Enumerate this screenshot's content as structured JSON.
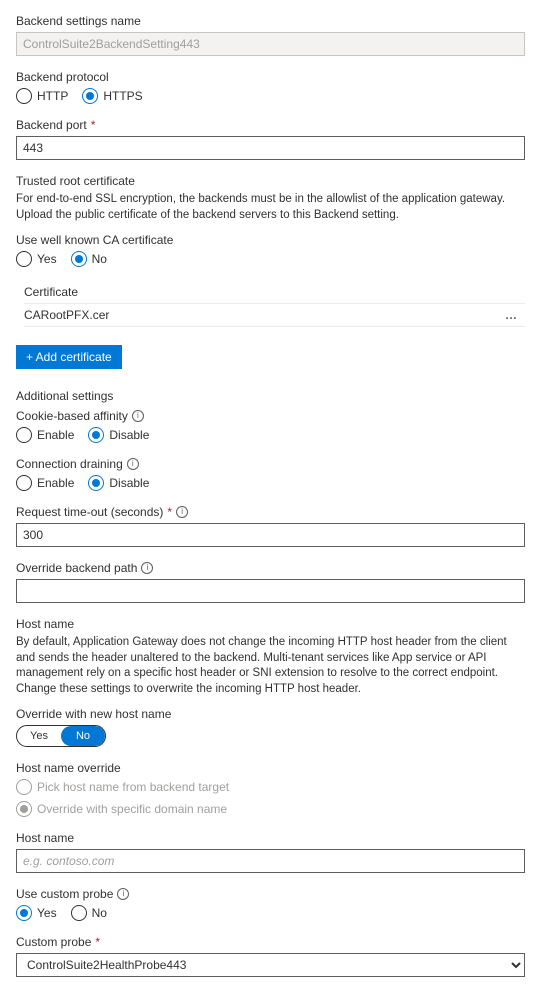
{
  "settings_name": {
    "label": "Backend settings name",
    "value": "ControlSuite2BackendSetting443"
  },
  "protocol": {
    "label": "Backend protocol",
    "options": {
      "http": "HTTP",
      "https": "HTTPS"
    },
    "selected": "https"
  },
  "port": {
    "label": "Backend port",
    "value": "443"
  },
  "trusted_cert": {
    "heading": "Trusted root certificate",
    "desc": "For end-to-end SSL encryption, the backends must be in the allowlist of the application gateway. Upload the public certificate of the backend servers to this Backend setting.",
    "use_wellknown_label": "Use well known CA certificate",
    "options": {
      "yes": "Yes",
      "no": "No"
    },
    "selected": "no",
    "cert_col": "Certificate",
    "cert_name": "CARootPFX.cer",
    "add_btn": "+ Add certificate"
  },
  "additional": {
    "heading": "Additional settings",
    "cookie": {
      "label": "Cookie-based affinity",
      "options": {
        "enable": "Enable",
        "disable": "Disable"
      },
      "selected": "disable"
    },
    "draining": {
      "label": "Connection draining",
      "options": {
        "enable": "Enable",
        "disable": "Disable"
      },
      "selected": "disable"
    },
    "timeout": {
      "label": "Request time-out (seconds)",
      "value": "300"
    },
    "override_path": {
      "label": "Override backend path",
      "value": ""
    }
  },
  "hostname": {
    "heading": "Host name",
    "desc": "By default, Application Gateway does not change the incoming HTTP host header from the client and sends the header unaltered to the backend. Multi-tenant services like App service or API management rely on a specific host header or SNI extension to resolve to the correct endpoint. Change these settings to overwrite the incoming HTTP host header.",
    "override_new": {
      "label": "Override with new host name",
      "options": {
        "yes": "Yes",
        "no": "No"
      },
      "selected": "no"
    },
    "override_kind": {
      "label": "Host name override",
      "options": {
        "pick": "Pick host name from backend target",
        "specific": "Override with specific domain name"
      },
      "selected": "specific"
    },
    "hostname_field": {
      "label": "Host name",
      "placeholder": "e.g. contoso.com",
      "value": ""
    }
  },
  "probe": {
    "use_custom": {
      "label": "Use custom probe",
      "options": {
        "yes": "Yes",
        "no": "No"
      },
      "selected": "yes"
    },
    "custom": {
      "label": "Custom probe",
      "value": "ControlSuite2HealthProbe443"
    }
  }
}
